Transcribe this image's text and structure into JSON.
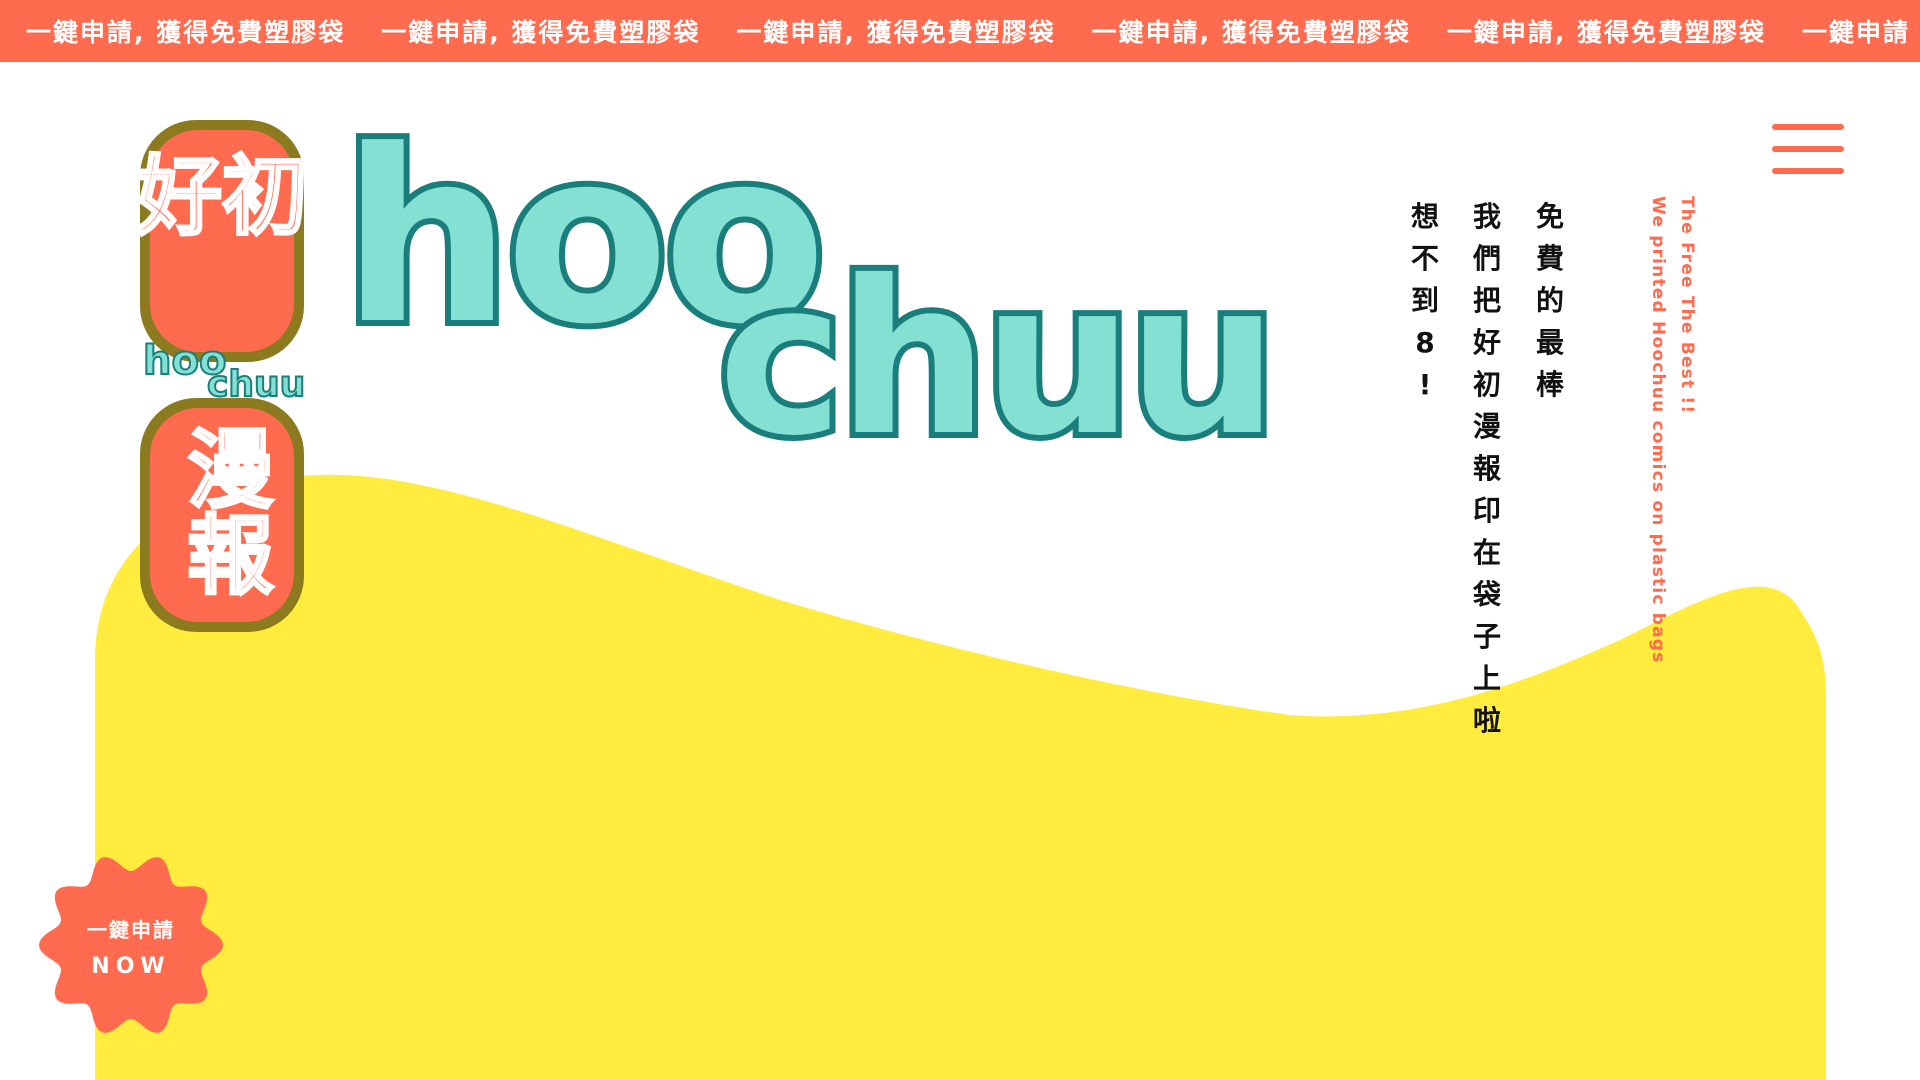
{
  "banner": {
    "items": [
      "一鍵申請, 獲得免費塑膠袋",
      "一鍵申請, 獲得免費塑膠袋",
      "一鍵申請, 獲得免費塑膠袋",
      "一鍵申請, 獲得免費塑膠袋",
      "一鍵申請, 獲得免費塑膠袋",
      "一鍵申請"
    ]
  },
  "brand": {
    "chinese_top": "好初",
    "chinese_bottom": "漫報",
    "small_logo_top": "hoo",
    "small_logo_bottom": "chuu",
    "wordmark_top": "hoo",
    "wordmark_bottom": "chuu"
  },
  "menu": {
    "icon": "hamburger-menu-icon"
  },
  "tagline": {
    "col1": [
      "免",
      "費",
      "的",
      "最",
      "棒"
    ],
    "col2": [
      "我",
      "們",
      "把",
      "好",
      "初",
      "漫",
      "報",
      "印",
      "在",
      "袋",
      "子",
      "上",
      "啦"
    ],
    "col3": [
      "想",
      "不",
      "到",
      "8",
      "!"
    ]
  },
  "english": {
    "line1": "The Free The Best !!",
    "line2": "We printed Hoochuu comics on plastic bags"
  },
  "cta": {
    "line1": "一鍵申請",
    "line2": "NOW"
  },
  "colors": {
    "accent": "#FF6B4F",
    "yellow": "#FFEC3F",
    "teal": "#84E0D3",
    "teal_outline": "#1A7E7D",
    "gold_outline": "#8C7A1E",
    "text": "#111111"
  }
}
